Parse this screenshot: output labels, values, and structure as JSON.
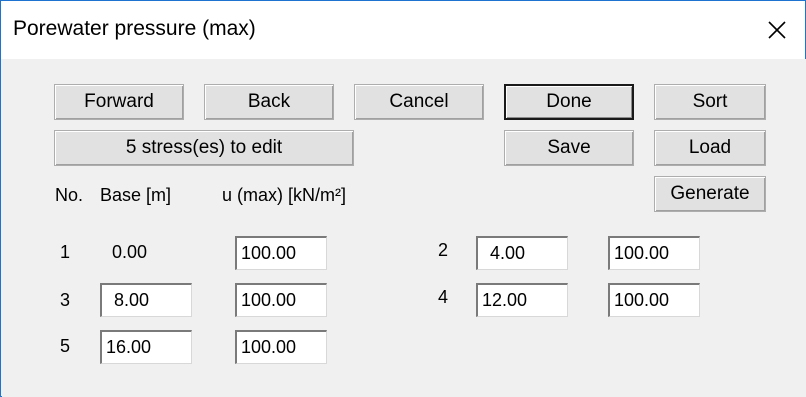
{
  "window": {
    "title": "Porewater pressure (max)"
  },
  "buttons": {
    "forward": "Forward",
    "back": "Back",
    "cancel": "Cancel",
    "done": "Done",
    "sort": "Sort",
    "edit_count": "5 stress(es) to edit",
    "save": "Save",
    "load": "Load",
    "generate": "Generate"
  },
  "columns": {
    "no": "No.",
    "base": "Base [m]",
    "u_max": "u (max) [kN/m²]"
  },
  "rows": [
    {
      "no": "1",
      "base": "0.00",
      "u": "100.00"
    },
    {
      "no": "2",
      "base": "4.00",
      "u": "100.00"
    },
    {
      "no": "3",
      "base": "8.00",
      "u": "100.00"
    },
    {
      "no": "4",
      "base": "12.00",
      "u": "100.00"
    },
    {
      "no": "5",
      "base": "16.00",
      "u": "100.00"
    }
  ],
  "icons": {
    "close": "close-icon"
  },
  "colors": {
    "window_border": "#1e73d0",
    "dialog_bg": "#f0f0f0"
  }
}
